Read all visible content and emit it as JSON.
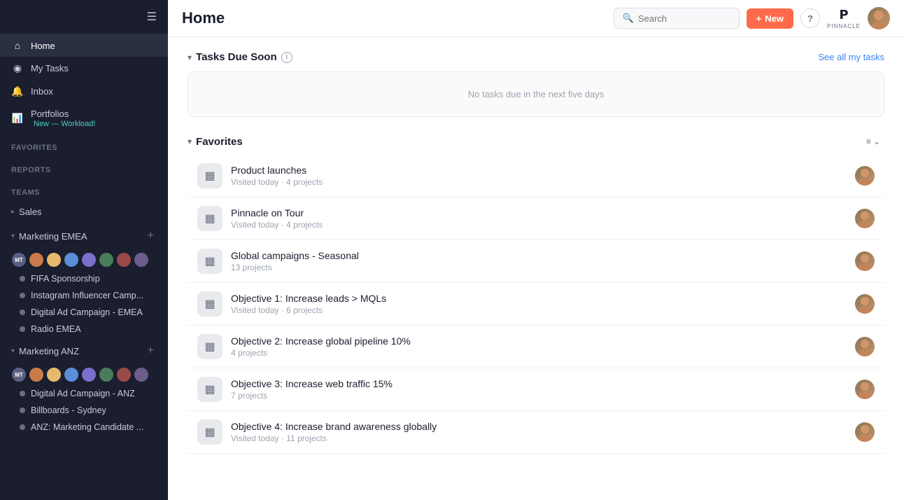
{
  "sidebar": {
    "nav": [
      {
        "id": "home",
        "icon": "⊙",
        "label": "Home",
        "active": true
      },
      {
        "id": "my-tasks",
        "icon": "✓",
        "label": "My Tasks"
      },
      {
        "id": "inbox",
        "icon": "🔔",
        "label": "Inbox"
      },
      {
        "id": "portfolios",
        "icon": "📊",
        "label": "Portfolios",
        "badge": "New — Workload!"
      }
    ],
    "sections": {
      "favorites_label": "Favorites",
      "reports_label": "Reports",
      "teams_label": "Teams"
    },
    "teams": [
      {
        "id": "sales",
        "name": "Sales",
        "collapsed": true,
        "projects": []
      },
      {
        "id": "marketing-emea",
        "name": "Marketing EMEA",
        "collapsed": false,
        "projects": [
          "FIFA Sponsorship",
          "Instagram Influencer Camp...",
          "Digital Ad Campaign - EMEA",
          "Radio EMEA"
        ]
      },
      {
        "id": "marketing-anz",
        "name": "Marketing ANZ",
        "collapsed": false,
        "projects": [
          "Digital Ad Campaign - ANZ",
          "Billboards - Sydney",
          "ANZ: Marketing Candidate ..."
        ]
      }
    ]
  },
  "topbar": {
    "title": "Home",
    "search_placeholder": "Search",
    "new_button_label": "New",
    "help_label": "?",
    "pinnacle_label": "PINNACLE"
  },
  "tasks_section": {
    "title": "Tasks Due Soon",
    "empty_message": "No tasks due in the next five days",
    "see_all_label": "See all my tasks"
  },
  "favorites_section": {
    "title": "Favorites",
    "items": [
      {
        "id": "product-launches",
        "name": "Product launches",
        "meta": "Visited today · 4 projects"
      },
      {
        "id": "pinnacle-on-tour",
        "name": "Pinnacle on Tour",
        "meta": "Visited today · 4 projects"
      },
      {
        "id": "global-campaigns",
        "name": "Global campaigns - Seasonal",
        "meta": "13 projects"
      },
      {
        "id": "objective-1",
        "name": "Objective 1: Increase leads > MQLs",
        "meta": "Visited today · 6 projects"
      },
      {
        "id": "objective-2",
        "name": "Objective 2: Increase global pipeline 10%",
        "meta": "4 projects"
      },
      {
        "id": "objective-3",
        "name": "Objective 3: Increase web traffic 15%",
        "meta": "7 projects"
      },
      {
        "id": "objective-4",
        "name": "Objective 4: Increase brand awareness globally",
        "meta": "Visited today · 11 projects"
      }
    ]
  },
  "icons": {
    "chart": "▦",
    "collapse_arrow": "▾",
    "expand_arrow": "▸",
    "sort": "≡",
    "chevron_down": "⌄",
    "plus": "+",
    "search": "🔍"
  }
}
